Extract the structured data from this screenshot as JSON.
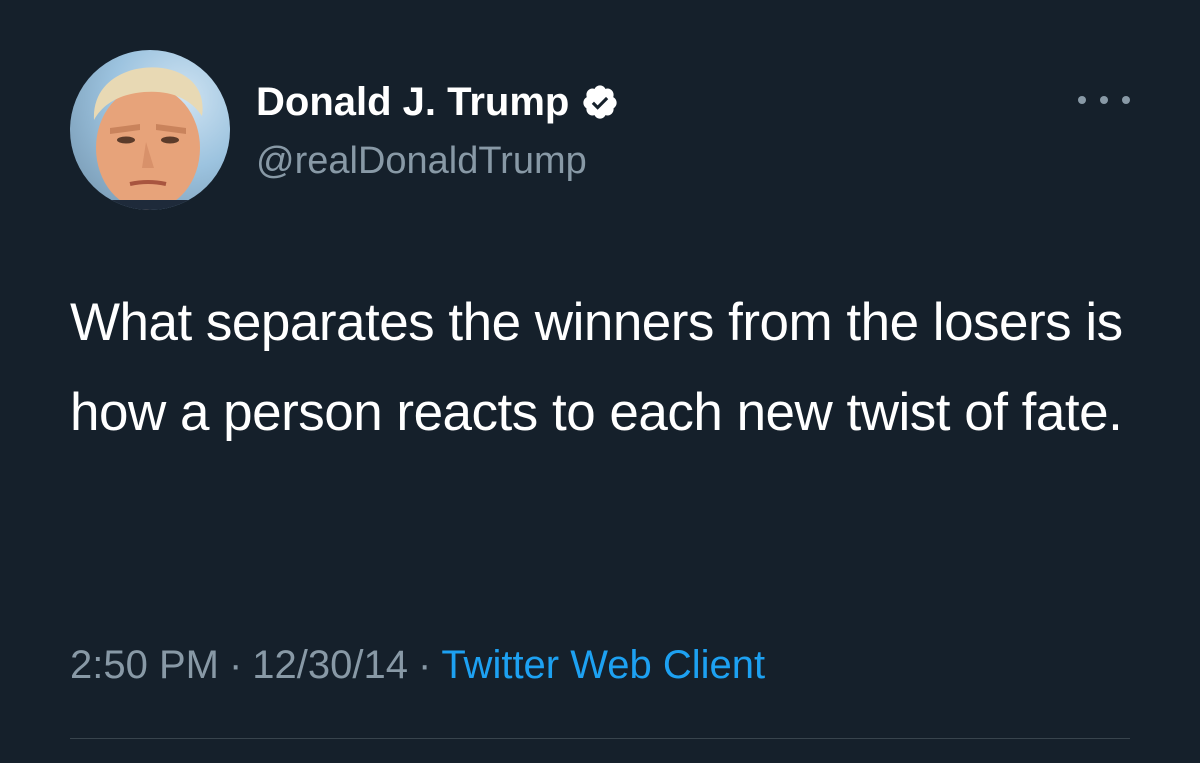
{
  "tweet": {
    "author": {
      "display_name": "Donald J. Trump",
      "handle": "@realDonaldTrump",
      "verified": true,
      "avatar_icon": "profile-photo"
    },
    "text": "What separates the winners from the losers is how a person reacts to each new twist of fate.",
    "time": "2:50 PM",
    "date": "12/30/14",
    "separator": "·",
    "client": "Twitter Web Client",
    "more_icon": "more-horizontal-icon"
  },
  "colors": {
    "background": "#15202b",
    "primary_text": "#ffffff",
    "secondary_text": "#8899a6",
    "link": "#1da1f2",
    "divider": "#38444d"
  }
}
